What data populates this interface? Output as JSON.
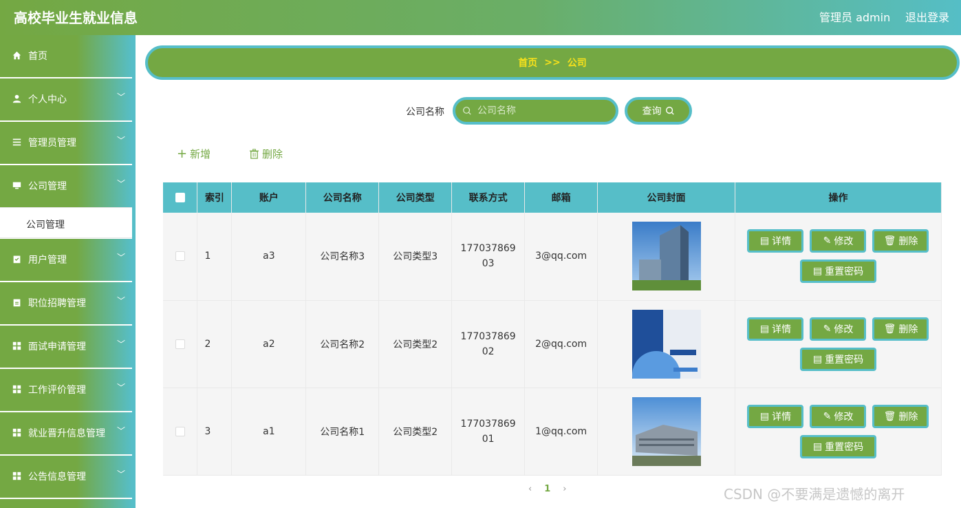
{
  "header": {
    "title": "高校毕业生就业信息",
    "user_label": "管理员 admin",
    "logout_label": "退出登录"
  },
  "sidebar": {
    "items": [
      {
        "label": "首页",
        "icon": "home-icon"
      },
      {
        "label": "个人中心",
        "icon": "user-icon"
      },
      {
        "label": "管理员管理",
        "icon": "list-icon"
      },
      {
        "label": "公司管理",
        "icon": "monitor-icon"
      },
      {
        "label": "用户管理",
        "icon": "clipboard-check-icon"
      },
      {
        "label": "职位招聘管理",
        "icon": "clipboard-icon"
      },
      {
        "label": "面试申请管理",
        "icon": "grid-icon"
      },
      {
        "label": "工作评价管理",
        "icon": "grid-icon"
      },
      {
        "label": "就业晋升信息管理",
        "icon": "grid-icon"
      },
      {
        "label": "公告信息管理",
        "icon": "grid-icon"
      }
    ],
    "sub_item": "公司管理"
  },
  "breadcrumb": {
    "home": "首页",
    "separator": ">>",
    "current": "公司"
  },
  "search": {
    "label": "公司名称",
    "placeholder": "公司名称",
    "value": "",
    "button": "查询"
  },
  "actions": {
    "add": "新增",
    "delete": "删除"
  },
  "table": {
    "headers": [
      "索引",
      "账户",
      "公司名称",
      "公司类型",
      "联系方式",
      "邮箱",
      "公司封面",
      "操作"
    ],
    "rows": [
      {
        "index": "1",
        "account": "a3",
        "name": "公司名称3",
        "type": "公司类型3",
        "phone": "17703786903",
        "email": "3@qq.com"
      },
      {
        "index": "2",
        "account": "a2",
        "name": "公司名称2",
        "type": "公司类型2",
        "phone": "17703786902",
        "email": "2@qq.com"
      },
      {
        "index": "3",
        "account": "a1",
        "name": "公司名称1",
        "type": "公司类型2",
        "phone": "17703786901",
        "email": "1@qq.com"
      }
    ],
    "row_actions": {
      "detail": "详情",
      "edit": "修改",
      "delete": "删除",
      "reset": "重置密码"
    }
  },
  "pager": {
    "current": "1"
  },
  "watermark": "CSDN @不要满是遗憾的离开",
  "colors": {
    "primary": "#74a843",
    "accent": "#56bec8",
    "breadcrumb_text": "#f7e11b"
  }
}
